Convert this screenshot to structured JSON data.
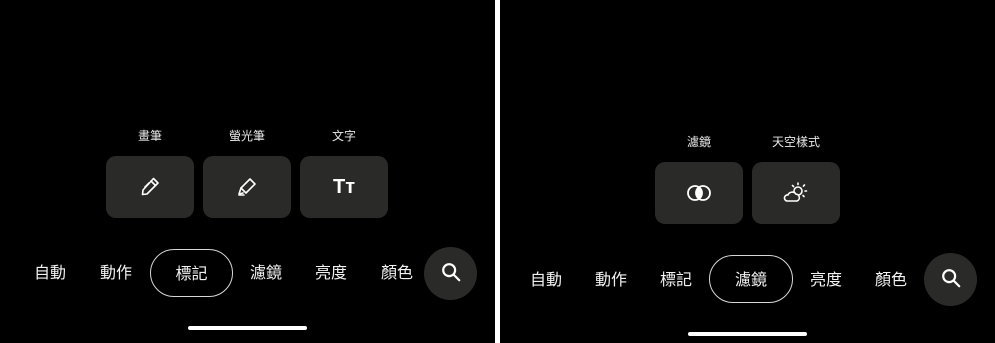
{
  "left": {
    "tools": [
      {
        "label": "畫筆",
        "icon": "pen-icon"
      },
      {
        "label": "螢光筆",
        "icon": "highlighter-icon"
      },
      {
        "label": "文字",
        "icon": "text-icon",
        "glyph": "Tт"
      }
    ],
    "tabs": [
      "自動",
      "動作",
      "標記",
      "濾鏡",
      "亮度",
      "顏色"
    ],
    "selected_tab": "標記",
    "search_icon": "search-icon"
  },
  "right": {
    "tools": [
      {
        "label": "濾鏡",
        "icon": "filter-icon"
      },
      {
        "label": "天空樣式",
        "icon": "sky-style-icon"
      }
    ],
    "tabs": [
      "自動",
      "動作",
      "標記",
      "濾鏡",
      "亮度",
      "顏色"
    ],
    "selected_tab": "濾鏡",
    "search_icon": "search-icon"
  },
  "colors": {
    "background": "#000000",
    "button": "#2a2a28",
    "text": "#f2f2f2",
    "divider": "#ffffff"
  }
}
